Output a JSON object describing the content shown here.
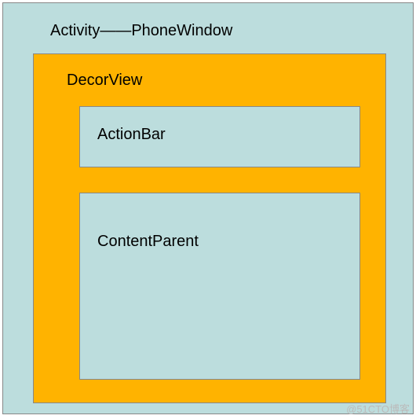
{
  "diagram": {
    "outer_label": "Activity——PhoneWindow",
    "decor_view_label": "DecorView",
    "action_bar_label": "ActionBar",
    "content_parent_label": "ContentParent"
  },
  "watermark": "@51CTO博客",
  "colors": {
    "background_teal": "#bcdddd",
    "decor_orange": "#ffb300",
    "border": "#888888"
  }
}
